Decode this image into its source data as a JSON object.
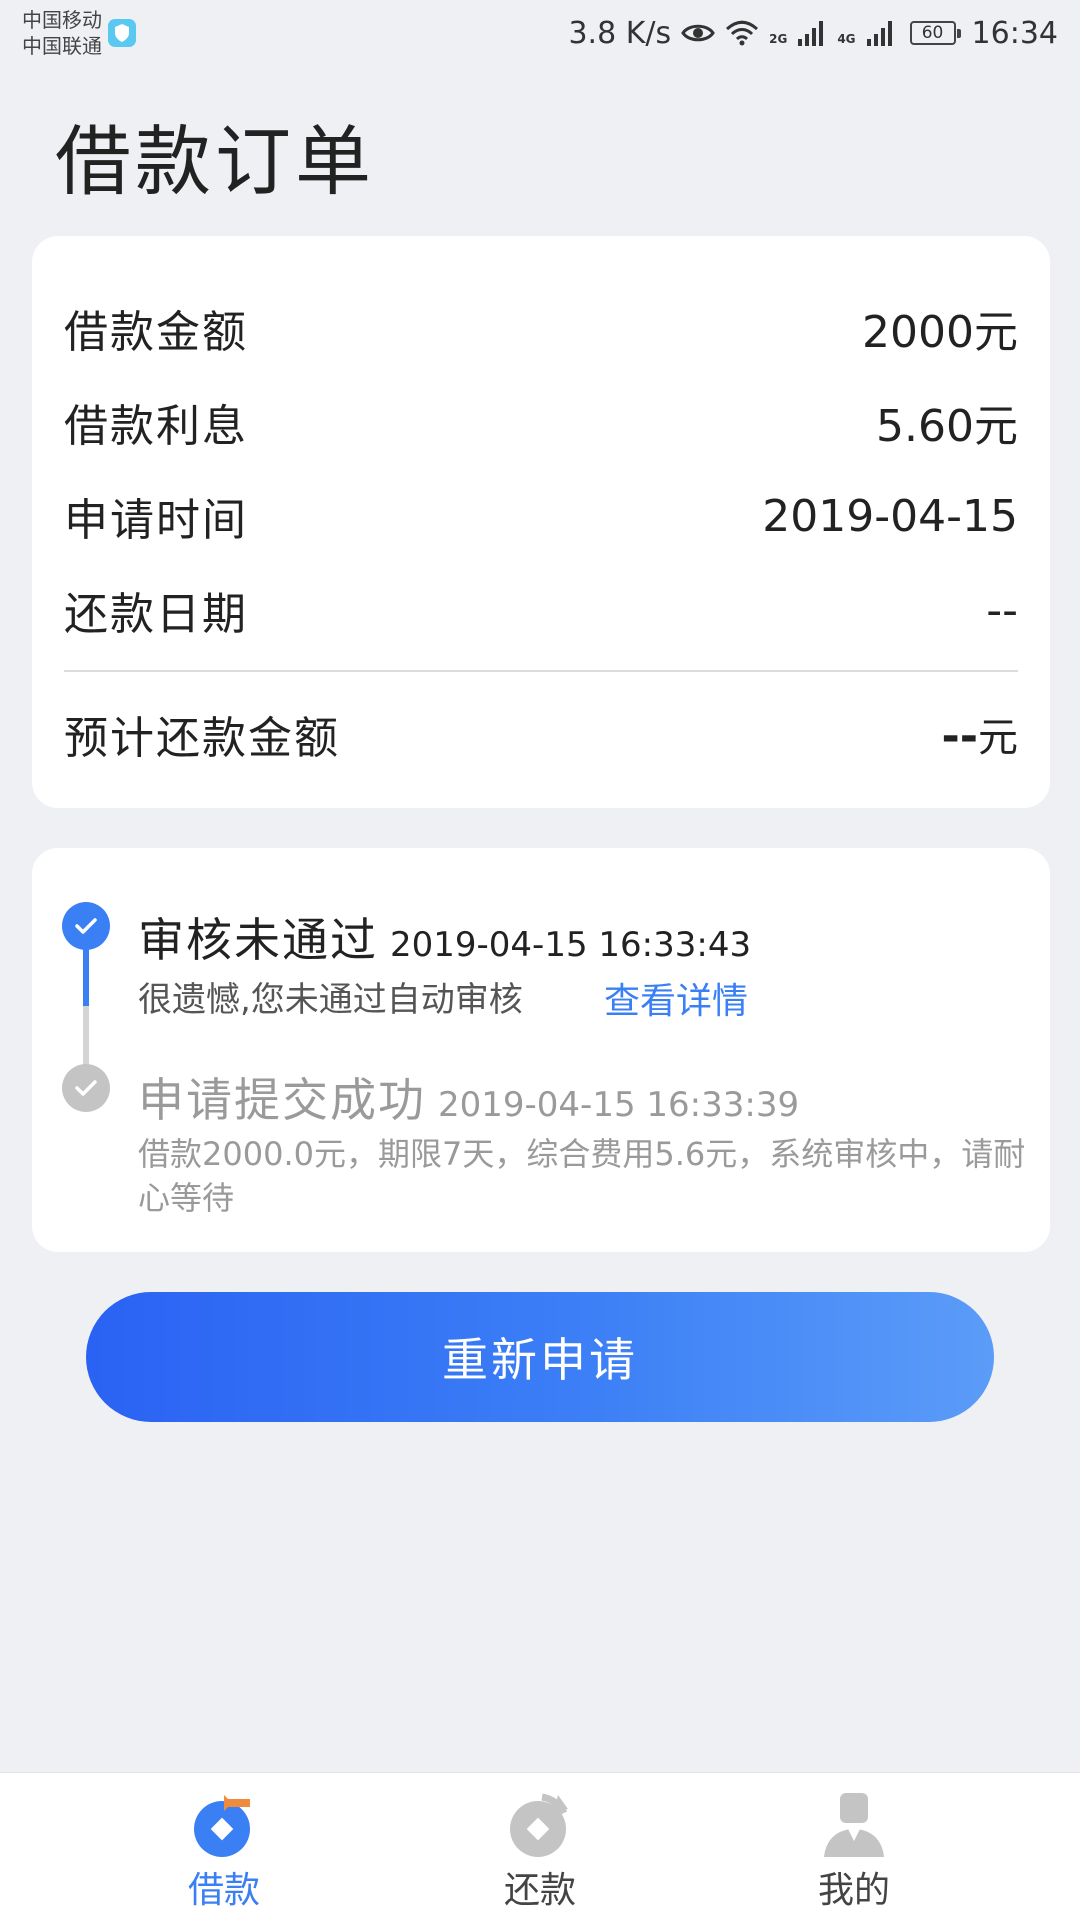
{
  "status_bar": {
    "carrier1": "中国移动",
    "carrier2": "中国联通",
    "speed": "3.8 K/s",
    "net1": "2G",
    "net2": "4G",
    "battery": "60",
    "time": "16:34"
  },
  "page_title": "借款订单",
  "summary": {
    "amount_label": "借款金额",
    "amount_value": "2000元",
    "interest_label": "借款利息",
    "interest_value": "5.60元",
    "apply_time_label": "申请时间",
    "apply_time_value": "2019-04-15",
    "repay_date_label": "还款日期",
    "repay_date_value": "--",
    "expected_total_label": "预计还款金额",
    "expected_total_dash": "--",
    "expected_total_unit": "元"
  },
  "timeline": [
    {
      "title": "审核未通过",
      "time": "2019-04-15 16:33:43",
      "desc": "很遗憾,您未通过自动审核",
      "link": "查看详情"
    },
    {
      "title": "申请提交成功",
      "time": "2019-04-15 16:33:39",
      "desc": "借款2000.0元，期限7天，综合费用5.6元，系统审核中，请耐心等待"
    }
  ],
  "reapply_label": "重新申请",
  "tabs": [
    {
      "label": "借款",
      "icon": "loan-icon",
      "active": true
    },
    {
      "label": "还款",
      "icon": "repay-icon",
      "active": false
    },
    {
      "label": "我的",
      "icon": "profile-icon",
      "active": false
    }
  ],
  "colors": {
    "accent": "#3b7ff5",
    "active_tab_badge": "#f08a3c",
    "inactive": "#c4c4c4",
    "background": "#eef0f4"
  }
}
